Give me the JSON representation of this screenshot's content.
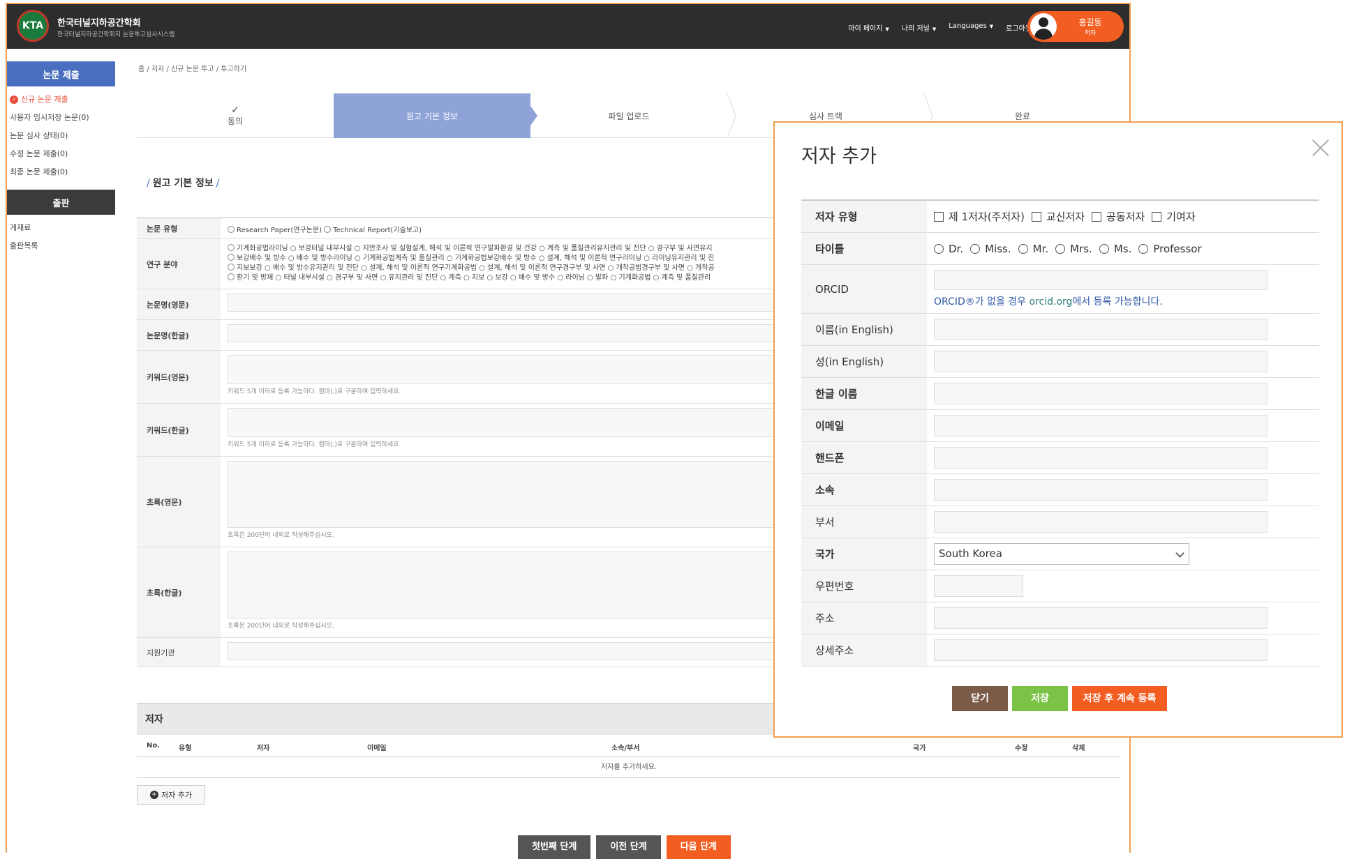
{
  "header": {
    "logo_text": "KTA",
    "site_title": "한국터널지하공간학회",
    "site_subtitle": "한국터널지하공간학회지 논문투고심사시스템",
    "nav": [
      "마이 페이지",
      "나의 저널",
      "Languages",
      "로그아웃"
    ],
    "user_name": "홍길동",
    "user_role": "저자"
  },
  "sidebar": {
    "submit_head": "논문 제출",
    "submit_items": [
      "신규 논문 제출",
      "사용자 임시저장 논문(0)",
      "논문 심사 상태(0)",
      "수정 논문 제출(0)",
      "최종 논문 제출(0)"
    ],
    "publish_head": "출판",
    "publish_items": [
      "게재료",
      "출판목록"
    ]
  },
  "breadcrumb": "홈 / 저자 / 신규 논문 투고 / 투고하기",
  "steps": [
    {
      "label": "동의",
      "check": "✓"
    },
    {
      "label": "원고 기본 정보"
    },
    {
      "label": "파일 업로드"
    },
    {
      "label": "심사 트랙"
    },
    {
      "label": "완료"
    }
  ],
  "section_title": "원고 기본 정보",
  "form": {
    "paper_type_label": "논문 유형",
    "paper_type_options": [
      "Research Paper(연구논문)",
      "Technical Report(기술보고)"
    ],
    "field_label": "연구 분야",
    "field_lines": [
      "기계화공법라이닝 ○ 보강터널 내부시설 ○ 지반조사 및 실험설계, 해석 및 이론적 연구발파환경 및 건강 ○ 계측 및 품질관리유지관리 및 진단 ○ 경구부 및 사면유지",
      "보강배수 및 방수 ○ 배수 및 방수라이닝 ○ 기계화공법계측 및 품질관리 ○ 기계화공법보강배수 및 방수 ○ 설계, 해석 및 이론적 연구라이닝 ○ 라이닝유지관리 및 진",
      "지보보강 ○ 배수 및 방수유지관리 및 진단 ○ 설계, 해석 및 이론적 연구기계화공법 ○ 설계, 해석 및 이론적 연구경구부 및 사면 ○ 개착공법경구부 및 사면 ○ 개착공",
      "환기 및 방재 ○ 터널 내부시설 ○ 경구부 및 사면 ○ 유지관리 및 진단 ○ 계측 ○ 지보 ○ 보강 ○ 배수 및 방수 ○ 라이닝 ○ 발파 ○ 기계화공법 ○ 계측 및 품질관리"
    ],
    "title_en_label": "논문명(영문)",
    "title_ko_label": "논문명(한글)",
    "kw_en_label": "키워드(영문)",
    "kw_ko_label": "키워드(한글)",
    "kw_hint": "키워드 5개 이하로 등록 가능하다. 컴마(,)로 구분하여 입력하세요.",
    "abs_en_label": "초록(영문)",
    "abs_ko_label": "초록(한글)",
    "abs_hint": "초록은 200단어 내외로 작성해주십시오.",
    "sponsor_label": "지원기관"
  },
  "authors": {
    "head": "저자",
    "cols": [
      "No.",
      "유형",
      "저자",
      "이메일",
      "소속/부서",
      "국가",
      "수정",
      "삭제"
    ],
    "empty": "저자를 추가하세요.",
    "add_btn": "저자 추가"
  },
  "bottom_buttons": [
    "첫번째 단계",
    "이전 단계",
    "다음 단계"
  ],
  "modal": {
    "title": "저자 추가",
    "type_label": "저자 유형",
    "type_options": [
      "제 1저자(주저자)",
      "교신저자",
      "공동저자",
      "기여자"
    ],
    "title_label": "타이틀",
    "title_options": [
      "Dr.",
      "Miss.",
      "Mr.",
      "Mrs.",
      "Ms.",
      "Professor"
    ],
    "orcid_label": "ORCID",
    "orcid_note_pre": "ORCID®가 없을 경우 ",
    "orcid_link": "orcid.org",
    "orcid_note_post": "에서 등록 가능합니다.",
    "fields": [
      "이름(in English)",
      "성(in English)",
      "한글 이름",
      "이메일",
      "핸드폰",
      "소속",
      "부서"
    ],
    "country_label": "국가",
    "country_value": "South Korea",
    "zip_label": "우편번호",
    "addr_label": "주소",
    "addr_detail_label": "상세주소",
    "buttons": [
      "닫기",
      "저장",
      "저장 후 계속 등록"
    ]
  }
}
